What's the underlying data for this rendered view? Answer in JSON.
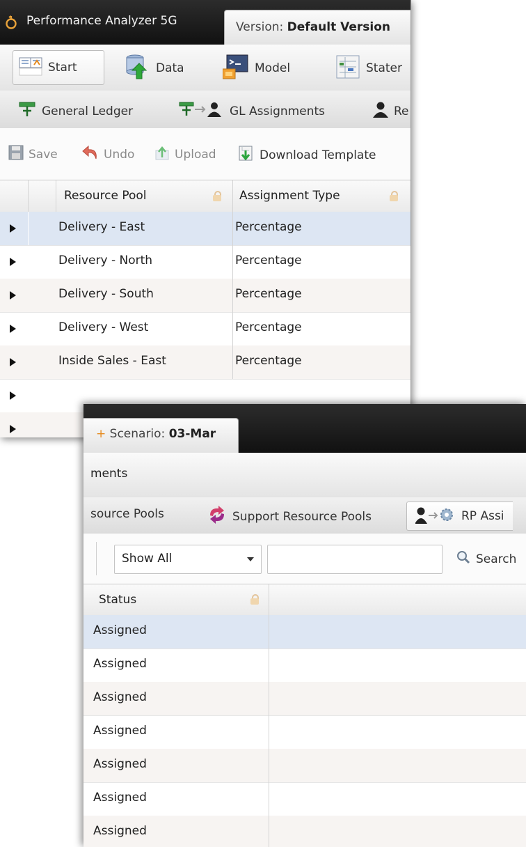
{
  "app": {
    "title": "Performance Analyzer 5G",
    "version_label": "Version:",
    "version_value": "Default Version",
    "scenario_plus": "+",
    "scenario_label": "Scenario:",
    "scenario_value": "03-Mar"
  },
  "top_nav": {
    "items": [
      {
        "label": "Start",
        "icon": "start-icon"
      },
      {
        "label": "Data",
        "icon": "database-icon"
      },
      {
        "label": "Model",
        "icon": "model-icon"
      },
      {
        "label": "Stater",
        "icon": "statements-icon"
      }
    ]
  },
  "sub_nav": {
    "items": [
      {
        "label": "General Ledger",
        "icon": "ledger-icon"
      },
      {
        "label": "GL Assignments",
        "icon": "gl-assignments-icon"
      },
      {
        "label": "Re",
        "icon": "person-icon"
      }
    ]
  },
  "toolbar": {
    "save": "Save",
    "undo": "Undo",
    "upload": "Upload",
    "download_template": "Download Template"
  },
  "grid": {
    "columns": [
      "Resource Pool",
      "Assignment Type"
    ],
    "rows": [
      {
        "resource_pool": "Delivery - East",
        "assignment_type": "Percentage"
      },
      {
        "resource_pool": "Delivery - North",
        "assignment_type": "Percentage"
      },
      {
        "resource_pool": "Delivery - South",
        "assignment_type": "Percentage"
      },
      {
        "resource_pool": "Delivery - West",
        "assignment_type": "Percentage"
      },
      {
        "resource_pool": "Inside Sales - East",
        "assignment_type": "Percentage"
      },
      {
        "resource_pool": "",
        "assignment_type": ""
      },
      {
        "resource_pool": "",
        "assignment_type": ""
      }
    ]
  },
  "panel2": {
    "breadcrumb": "ments",
    "sub_nav": [
      "source Pools",
      "Support Resource Pools",
      "RP Assi"
    ],
    "filter": {
      "selected": "Show All",
      "search_value": "",
      "search_button": "Search"
    },
    "status_header": "Status",
    "status_rows": [
      "Assigned",
      "Assigned",
      "Assigned",
      "Assigned",
      "Assigned",
      "Assigned",
      "Assigned"
    ]
  },
  "colors": {
    "titlebar": "#111111",
    "selected_row": "#dde6f3",
    "alt_row": "#f7f4f2",
    "lock": "#f0d6ae",
    "logo": "#e8a23a"
  }
}
